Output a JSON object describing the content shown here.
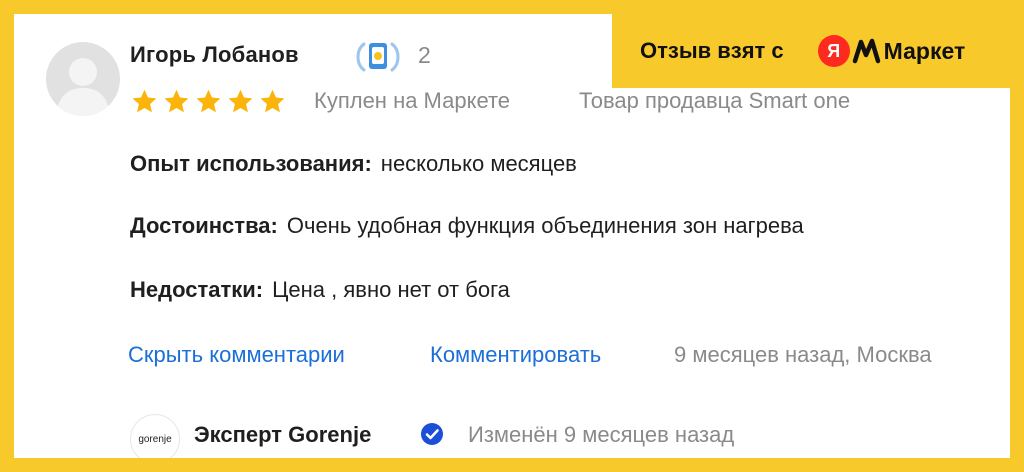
{
  "review": {
    "author": "Игорь Лобанов",
    "badge_count": "2",
    "rating": 5,
    "purchase_source": "Куплен на Маркете",
    "seller": "Товар продавца Smart one",
    "usage_label": "Опыт использования:",
    "usage_value": "несколько месяцев",
    "pros_label": "Достоинства:",
    "pros_value": "Очень удобная функция объединения зон нагрева",
    "cons_label": "Недостатки:",
    "cons_value": "Цена , явно нет от бога",
    "hide_comments": "Скрыть комментарии",
    "comment": "Комментировать",
    "date_location": "9 месяцев назад, Москва"
  },
  "expert": {
    "logo_text": "gorenje",
    "name": "Эксперт Gorenje",
    "edited": "Изменён 9 месяцев назад"
  },
  "source": {
    "text": "Отзыв взят с",
    "brand_letter": "Я",
    "brand_name": "Маркет"
  },
  "colors": {
    "frame": "#f8c92a",
    "star": "#fbb40a",
    "link": "#1c6fd8",
    "muted": "#8a8a8a",
    "brand_red": "#ff2a1f"
  },
  "icons": {
    "stars": "star-icon",
    "badge": "reviewer-badge-icon",
    "verified": "verified-check-icon"
  }
}
